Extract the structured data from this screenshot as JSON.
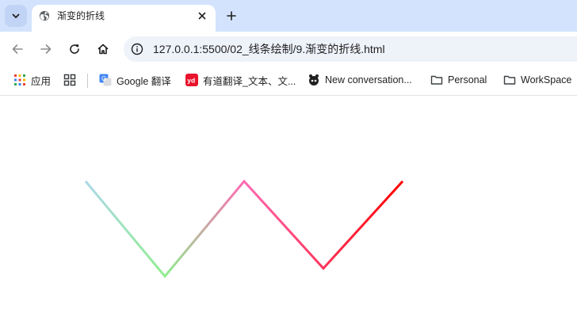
{
  "browser": {
    "tab": {
      "title": "渐变的折线"
    },
    "address": {
      "url": "127.0.0.1:5500/02_线条绘制/9.渐变的折线.html"
    },
    "bookmarks": [
      {
        "label": "应用",
        "icon": "apps-grid-icon"
      },
      {
        "label": "",
        "icon": "grid-icon"
      },
      {
        "label": "Google 翻译",
        "icon": "google-translate-icon"
      },
      {
        "label": "有道翻译_文本、文...",
        "icon": "youdao-icon"
      },
      {
        "label": "New conversation...",
        "icon": "bot-icon"
      },
      {
        "label": "Personal",
        "icon": "folder-icon"
      },
      {
        "label": "WorkSpace",
        "icon": "folder-icon"
      }
    ]
  },
  "canvas": {
    "polyline": {
      "gradient_colors": [
        "#add8e6",
        "#90ee90",
        "#ff69b4",
        "#ff0000"
      ]
    }
  }
}
